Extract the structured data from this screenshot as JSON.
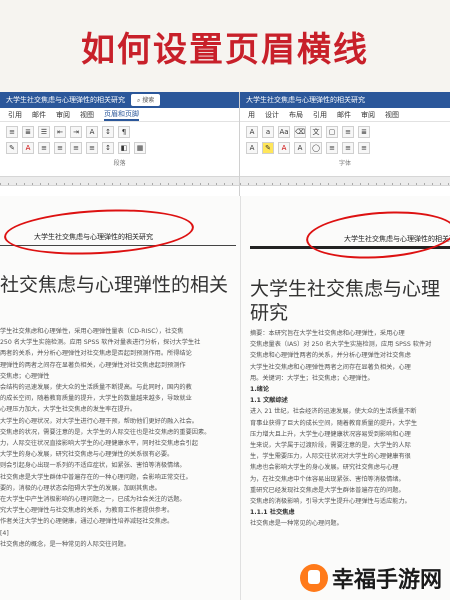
{
  "title": "如何设置页眉横线",
  "left_window": {
    "doc_name": "大学生社交焦虑与心理弹性的相关研究",
    "search": "搜索",
    "tabs": [
      "引用",
      "邮件",
      "审阅",
      "视图",
      "页眉和页脚"
    ],
    "group_label": "段落"
  },
  "right_window": {
    "doc_name": "大学生社交焦虑与心理弹性的相关研究",
    "tabs": [
      "用",
      "设计",
      "布局",
      "引用",
      "邮件",
      "审阅",
      "视图"
    ],
    "group_label": "字体"
  },
  "left_page": {
    "header_text": "大学生社交焦虑与心理弹性的相关研究",
    "heading": "社交焦虑与心理弹性的相关",
    "body": [
      "学生社交焦虑和心理弹性，采用心理弹性量表（CD-RISC），社交焦",
      "250 名大学生实施检测。应用 SPSS 软件对量表进行分析，探讨大学生社",
      "两者的关系，并分析心理弹性对社交焦虑是否起到预测作用。所得结论",
      "",
      "理弹性的两者之间存在显著负相关，心理弹性对社交焦虑起到预测作",
      "交焦虑；心理弹性",
      "",
      "",
      "会结构的迅速发展，使大众的生活质量不断提高。与此同时，国内的教",
      "的成长空间，随着教育质量的提升，大学生的数量越来越多，导致就业",
      "心理压力加大，大学生社交焦虑的发生率在提升。",
      "大学生的心理状况，对大学生进行心理干预，帮助他们更好的融入社会。",
      "交焦虑的状况，需要注意的是，大学生的人际交往也是社交焦虑的重要因素。",
      "力，人际交往状况直接影响大学生的心理健康水平，同时社交焦虑会引起",
      "大学生的身心发展，研究社交焦虑与心理弹性的关系很有必要。",
      "则会引起身心出现一系列的不适应症状，如紧张、害怕等消极情绪。",
      "社交焦虑是大学生群体中普遍存在的一种心理问题，会影响正常交往。",
      "要的，消极的心理状态会阻碍大学生的发展，加剧其焦虑。",
      "在大学生中产生消极影响的心理问题之一，已成为社会关注的话题。",
      "究大学生心理弹性与社交焦虑的关系，为教育工作者提供参考。",
      "作者关注大学生的心理健康，通过心理弹性培养减轻社交焦虑。",
      "[4]",
      "",
      "社交焦虑的概念，是一种常见的人际交往问题。"
    ]
  },
  "right_page": {
    "header_text": "大学生社交焦虑与心理弹性的相关研",
    "heading_line1": "大学生社交焦虑与心理",
    "heading_line2": "研究",
    "body": [
      "摘要：本研究旨在大学生社交焦虑和心理弹性，采用心理",
      "交焦虑量表（IAS）对 250 名大学生实施检测，应用 SPSS 软件对",
      "交焦虑和心理弹性两者的关系，并分析心理弹性对社交焦虑",
      "",
      "大学生社交焦虑和心理弹性两者之间存在显著负相关，心理",
      "用。关键词：大学生；社交焦虑；心理弹性。",
      "",
      "1.绪论",
      "",
      "1.1 文献综述",
      "",
      "进入 21 世纪，社会经济的迅速发展，使大众的生活质量不断",
      "育事业获得了巨大的成长空间，随着教育质量的提升，大学生",
      "压力增大且上升，大学生心理健康状况容易受到影响和心理",
      "生来说，大学属于过渡阶段，需要注意的是，大学生的人际",
      "生，学生需要压力，人际交往状况对大学生的心理健康有很",
      "焦虑也会影响大学生的身心发展。研究社交焦虑与心理",
      "为，在社交焦虑中个体容易出现紧张、害怕等消极情绪。",
      "重研究已经发现社交焦虑是大学生群体普遍存在的问题。",
      "交焦虑的消极影响，引导大学生提升心理弹性与适应能力。",
      "1.1.1 社交焦虑",
      "",
      "社交焦虑是一种常见的心理问题。"
    ]
  },
  "watermark": "幸福手游网"
}
